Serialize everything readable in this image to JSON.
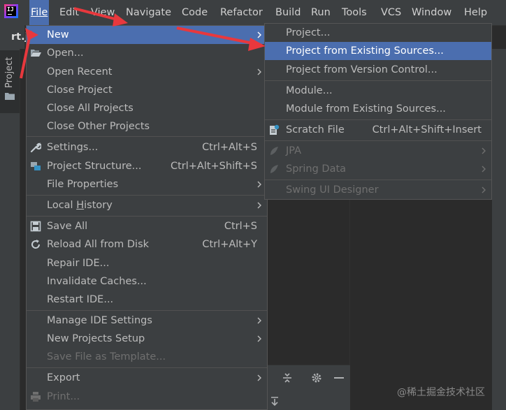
{
  "colors": {
    "menu_bg": "#3c3f41",
    "selection": "#4b6eaf",
    "editor_bg": "#2b2b2b",
    "annotation_arrow": "#e8383d"
  },
  "menubar": {
    "items": [
      {
        "label": "File",
        "mnemonic_index": 0
      },
      {
        "label": "Edit",
        "mnemonic_index": 0
      },
      {
        "label": "View",
        "mnemonic_index": 0
      },
      {
        "label": "Navigate",
        "mnemonic_index": 0
      },
      {
        "label": "Code",
        "mnemonic_index": 0
      },
      {
        "label": "Refactor",
        "mnemonic_index": 0
      },
      {
        "label": "Build",
        "mnemonic_index": 0
      },
      {
        "label": "Run",
        "mnemonic_index": 1
      },
      {
        "label": "Tools",
        "mnemonic_index": 0
      },
      {
        "label": "VCS",
        "mnemonic_index": -1
      },
      {
        "label": "Window",
        "mnemonic_index": 0
      },
      {
        "label": "Help",
        "mnemonic_index": 0
      }
    ]
  },
  "editor": {
    "tab_label": "rt.j"
  },
  "tool_window": {
    "project_label": "Project"
  },
  "file_menu": {
    "items": {
      "new": "New",
      "open": "Open...",
      "open_recent": "Open Recent",
      "close_project": "Close Project",
      "close_all_projects": "Close All Projects",
      "close_other_projects": "Close Other Projects",
      "settings": "Settings...",
      "settings_shortcut": "Ctrl+Alt+S",
      "project_structure": "Project Structure...",
      "project_structure_shortcut": "Ctrl+Alt+Shift+S",
      "file_properties": "File Properties",
      "local_history": "Local History",
      "save_all": "Save All",
      "save_all_shortcut": "Ctrl+S",
      "reload_all": "Reload All from Disk",
      "reload_all_shortcut": "Ctrl+Alt+Y",
      "repair_ide": "Repair IDE...",
      "invalidate_caches": "Invalidate Caches...",
      "restart_ide": "Restart IDE...",
      "manage_ide_settings": "Manage IDE Settings",
      "new_projects_setup": "New Projects Setup",
      "save_as_template": "Save File as Template...",
      "export": "Export",
      "print": "Print..."
    }
  },
  "new_menu": {
    "items": {
      "project": "Project...",
      "project_existing": "Project from Existing Sources...",
      "project_vcs": "Project from Version Control...",
      "module": "Module...",
      "module_existing": "Module from Existing Sources...",
      "scratch_file": "Scratch File",
      "scratch_file_shortcut": "Ctrl+Alt+Shift+Insert",
      "jpa": "JPA",
      "spring_data": "Spring Data",
      "swing_ui_designer": "Swing UI Designer"
    }
  },
  "watermark": "@稀土掘金技术社区"
}
